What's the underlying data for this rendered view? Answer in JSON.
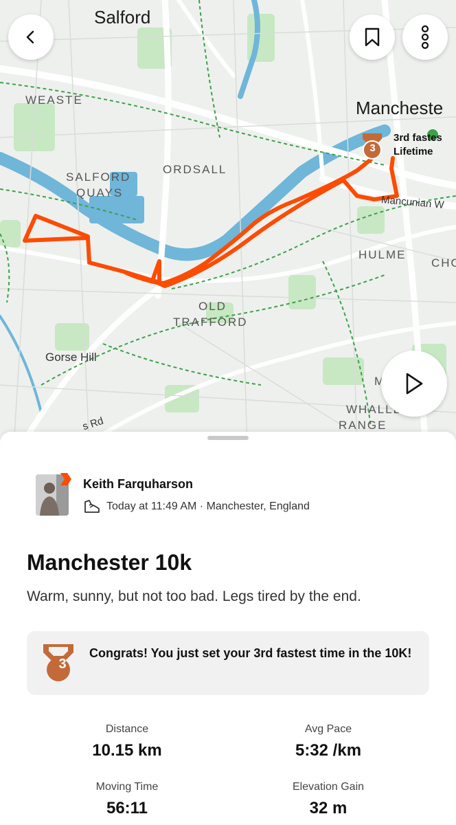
{
  "map": {
    "labels": {
      "salford": "Salford",
      "manchester": "Mancheste",
      "weaste": "WEASTE",
      "ordsall": "ORDSALL",
      "salford_quays_1": "SALFORD",
      "salford_quays_2": "QUAYS",
      "hulme": "HULME",
      "cho": "CHO",
      "old_trafford_1": "OLD",
      "old_trafford_2": "TRAFFORD",
      "gorse_hill": "Gorse Hill",
      "mancunian_way": "Mancunian W",
      "rd": "s Rd",
      "whalley_range_1": "WHALLE",
      "whalley_range_2": "RANGE",
      "moss_side": "M      E"
    },
    "annotation": {
      "line1": "3rd fastes",
      "line2": "Lifetime",
      "medal_number": "3"
    },
    "colors": {
      "route": "#fc4c02",
      "water": "#6fb6d9",
      "park": "#c7e8c3",
      "medal": "#c26a3a"
    }
  },
  "buttons": {
    "back": "chevron-left-icon",
    "bookmark": "bookmark-icon",
    "more": "more-vertical-icon",
    "play": "play-icon"
  },
  "athlete": {
    "name": "Keith Farquharson",
    "meta": "Today at 11:49 AM · Manchester, England"
  },
  "activity": {
    "title": "Manchester 10k",
    "description": "Warm, sunny, but not too bad. Legs tired by the end."
  },
  "achievement": {
    "medal_number": "3",
    "text": "Congrats! You just set your 3rd fastest time in the 10K!"
  },
  "stats": {
    "distance": {
      "label": "Distance",
      "value": "10.15 km"
    },
    "avg_pace": {
      "label": "Avg Pace",
      "value": "5:32 /km"
    },
    "moving_time": {
      "label": "Moving Time",
      "value": "56:11"
    },
    "elevation_gain": {
      "label": "Elevation Gain",
      "value": "32 m"
    }
  }
}
